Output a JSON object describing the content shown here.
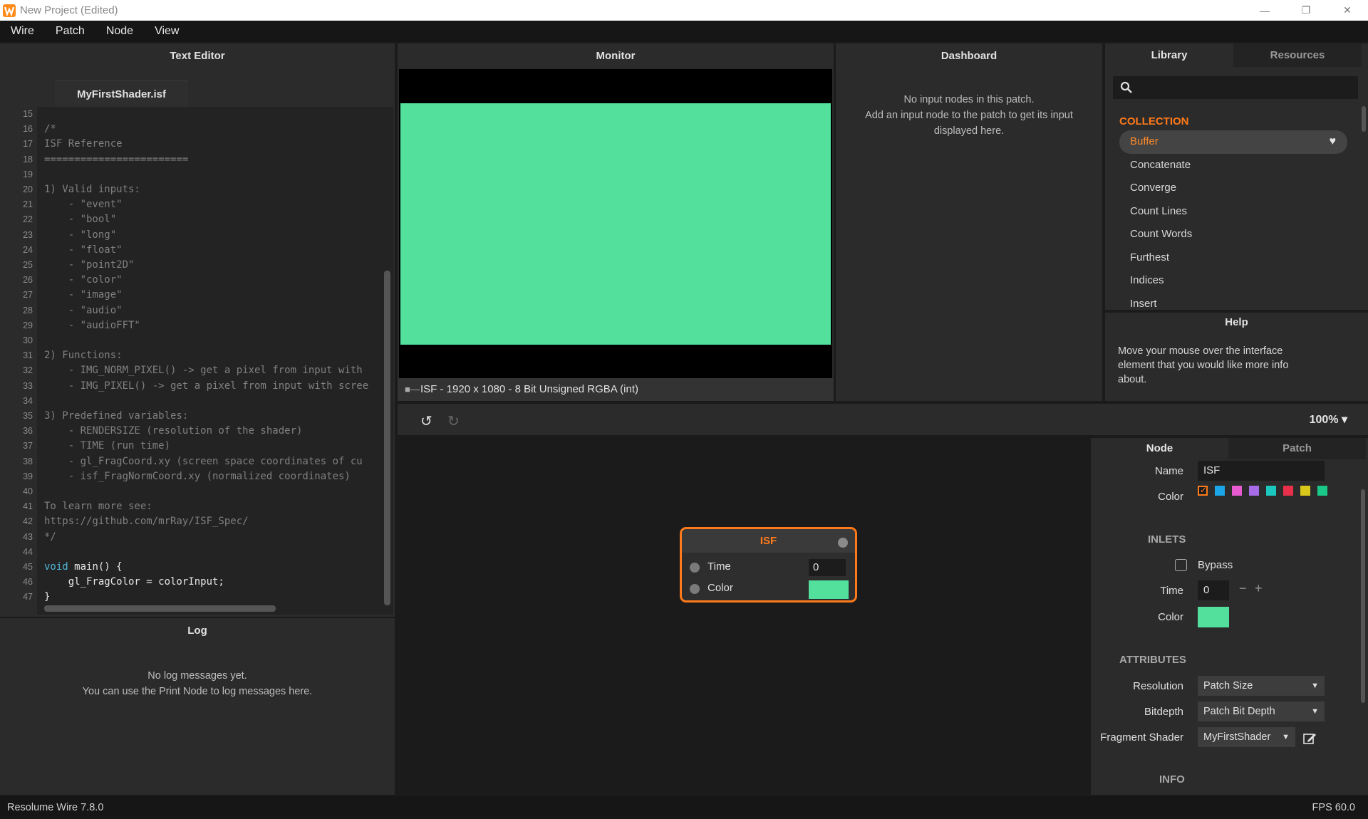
{
  "window": {
    "title": "New Project (Edited)",
    "controls": [
      "—",
      "❐",
      "✕"
    ]
  },
  "menu": [
    "Wire",
    "Patch",
    "Node",
    "View"
  ],
  "text_editor": {
    "title": "Text Editor",
    "file_tab": "MyFirstShader.isf",
    "lines": [
      {
        "n": "15",
        "text": ""
      },
      {
        "n": "16",
        "text": "/*"
      },
      {
        "n": "17",
        "text": "ISF Reference"
      },
      {
        "n": "18",
        "text": "========================"
      },
      {
        "n": "19",
        "text": ""
      },
      {
        "n": "20",
        "text": "1) Valid inputs:"
      },
      {
        "n": "21",
        "text": "    - \"event\""
      },
      {
        "n": "22",
        "text": "    - \"bool\""
      },
      {
        "n": "23",
        "text": "    - \"long\""
      },
      {
        "n": "24",
        "text": "    - \"float\""
      },
      {
        "n": "25",
        "text": "    - \"point2D\""
      },
      {
        "n": "26",
        "text": "    - \"color\""
      },
      {
        "n": "27",
        "text": "    - \"image\""
      },
      {
        "n": "28",
        "text": "    - \"audio\""
      },
      {
        "n": "29",
        "text": "    - \"audioFFT\""
      },
      {
        "n": "30",
        "text": ""
      },
      {
        "n": "31",
        "text": "2) Functions:"
      },
      {
        "n": "32",
        "text": "    - IMG_NORM_PIXEL() -> get a pixel from input with"
      },
      {
        "n": "33",
        "text": "    - IMG_PIXEL() -> get a pixel from input with scree"
      },
      {
        "n": "34",
        "text": ""
      },
      {
        "n": "35",
        "text": "3) Predefined variables:"
      },
      {
        "n": "36",
        "text": "    - RENDERSIZE (resolution of the shader)"
      },
      {
        "n": "37",
        "text": "    - TIME (run time)"
      },
      {
        "n": "38",
        "text": "    - gl_FragCoord.xy (screen space coordinates of cu"
      },
      {
        "n": "39",
        "text": "    - isf_FragNormCoord.xy (normalized coordinates)"
      },
      {
        "n": "40",
        "text": ""
      },
      {
        "n": "41",
        "text": "To learn more see:"
      },
      {
        "n": "42",
        "text": "https://github.com/mrRay/ISF_Spec/"
      },
      {
        "n": "43",
        "text": "*/"
      },
      {
        "n": "44",
        "text": ""
      },
      {
        "n": "45",
        "text": "main() {",
        "kw": "void "
      },
      {
        "n": "46",
        "text": "    gl_FragColor = colorInput;"
      },
      {
        "n": "47",
        "text": "}"
      }
    ]
  },
  "log": {
    "title": "Log",
    "line1": "No log messages yet.",
    "line2": "You can use the Print Node to log messages here."
  },
  "monitor": {
    "title": "Monitor",
    "info": "ISF - 1920 x 1080 - 8 Bit Unsigned RGBA (int)",
    "fill_color": "#52e09c"
  },
  "dashboard": {
    "title": "Dashboard",
    "line1": "No input nodes in this patch.",
    "line2": "Add an input node to the patch to get its input displayed here."
  },
  "library": {
    "tab_library": "Library",
    "tab_resources": "Resources",
    "search_placeholder": "",
    "collection": "COLLECTION",
    "items": [
      "Buffer",
      "Concatenate",
      "Converge",
      "Count Lines",
      "Count Words",
      "Furthest",
      "Indices",
      "Insert"
    ]
  },
  "help": {
    "title": "Help",
    "text": "Move your mouse over the interface element that you would like more info about."
  },
  "patch": {
    "zoom": "100%"
  },
  "node": {
    "title": "ISF",
    "inlets": [
      {
        "label": "Time",
        "value": "0"
      },
      {
        "label": "Color",
        "value": ""
      }
    ],
    "color": "#52e09c",
    "accent": "#ff7a1a"
  },
  "inspector": {
    "tab_node": "Node",
    "tab_patch": "Patch",
    "name_label": "Name",
    "name_value": "ISF",
    "color_label": "Color",
    "swatches": [
      "#1c1c1c",
      "#1aa6e8",
      "#e85bd0",
      "#a86be8",
      "#1ac8c0",
      "#e8304a",
      "#d8c81a",
      "#1ac88a"
    ],
    "inlets_header": "INLETS",
    "bypass_label": "Bypass",
    "time_label": "Time",
    "time_value": "0",
    "stepper_minus": "−",
    "stepper_plus": "+",
    "color2_label": "Color",
    "attributes_header": "ATTRIBUTES",
    "resolution_label": "Resolution",
    "resolution_value": "Patch Size",
    "bitdepth_label": "Bitdepth",
    "bitdepth_value": "Patch Bit Depth",
    "shader_label": "Fragment Shader",
    "shader_value": "MyFirstShader",
    "info_header": "INFO"
  },
  "status": {
    "version": "Resolume Wire 7.8.0",
    "fps": "FPS 60.0"
  }
}
